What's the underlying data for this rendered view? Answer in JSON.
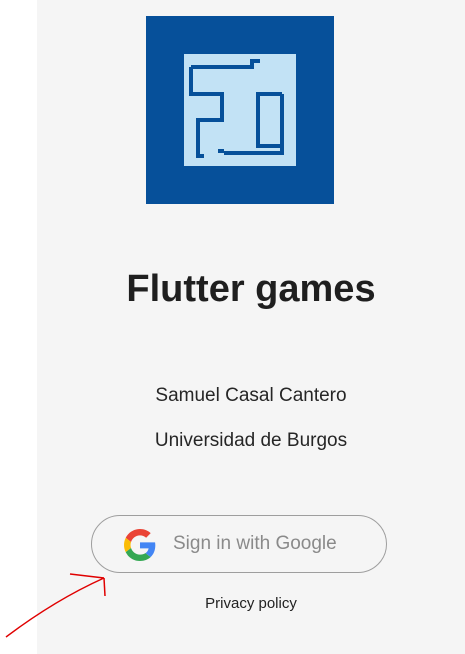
{
  "app": {
    "title": "Flutter games",
    "author": "Samuel Casal Cantero",
    "university": "Universidad de Burgos"
  },
  "signin": {
    "label": "Sign in with Google",
    "icon": "google-g-icon"
  },
  "privacy": {
    "label": "Privacy policy"
  },
  "colors": {
    "logo_dark": "#06509a",
    "logo_light": "#c2e2f5",
    "annotation": "#e00000",
    "background": "#f5f5f5"
  }
}
